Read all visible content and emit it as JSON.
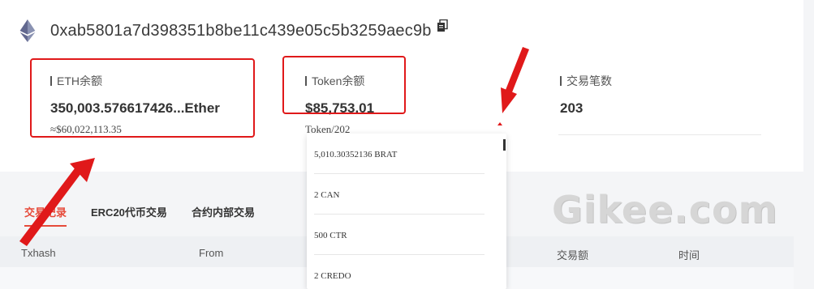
{
  "address": {
    "value": "0xab5801a7d398351b8be11c439e05c5b3259aec9b",
    "logo_icon": "ethereum-icon",
    "copy_icon": "copy-icon"
  },
  "stats": {
    "eth": {
      "label": "ETH余额",
      "value": "350,003.576617426...Ether",
      "sub": "≈$60,022,113.35"
    },
    "token": {
      "label": "Token余额",
      "value": "$85,753.01",
      "sub": "Token/202"
    },
    "tx": {
      "label": "交易笔数",
      "value": "203"
    }
  },
  "token_dropdown": {
    "items": [
      "5,010.30352136 BRAT",
      "2 CAN",
      "500 CTR",
      "2 CREDO"
    ]
  },
  "tabs": [
    "交易记录",
    "ERC20代币交易",
    "合约内部交易"
  ],
  "table": {
    "headers": [
      "Txhash",
      "From",
      "交易额",
      "时间"
    ]
  },
  "watermark": "Gikee.com",
  "colors": {
    "highlight_red": "#e0191a",
    "accent": "#e64a3a",
    "eth_logo": "#8a92b2"
  }
}
